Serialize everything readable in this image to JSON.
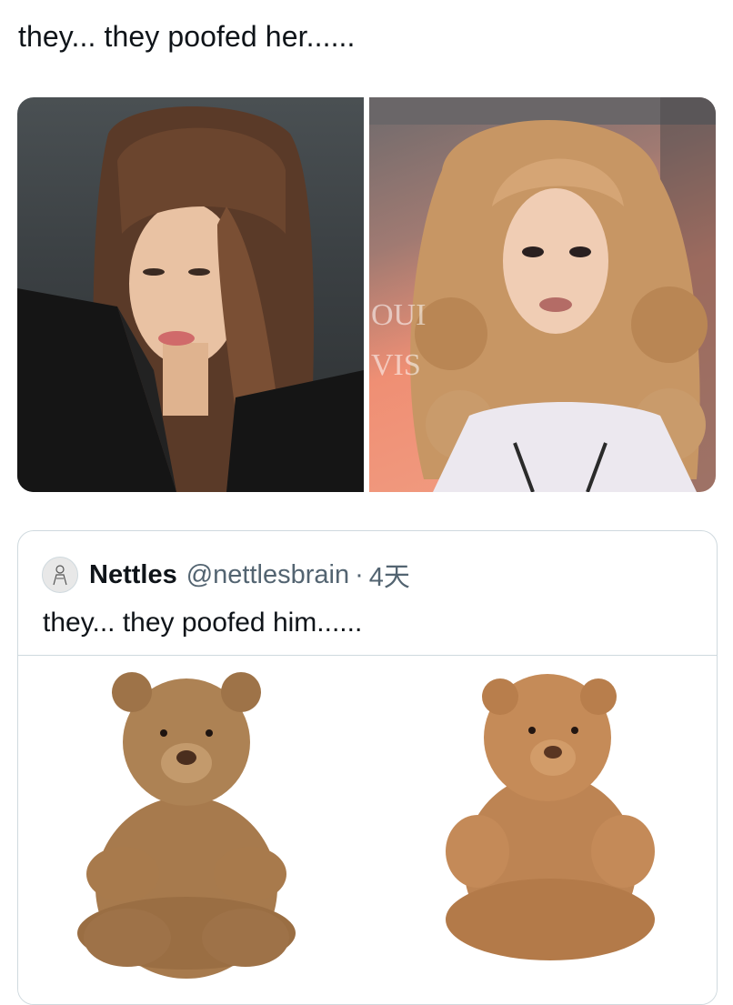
{
  "post": {
    "text": "they... they poofed her......"
  },
  "quoted_tweet": {
    "display_name": "Nettles",
    "handle": "@nettlesbrain",
    "separator": "·",
    "timestamp": "4天",
    "text": "they... they poofed him......"
  },
  "icons": {
    "avatar": "sketch-avatar-icon"
  }
}
